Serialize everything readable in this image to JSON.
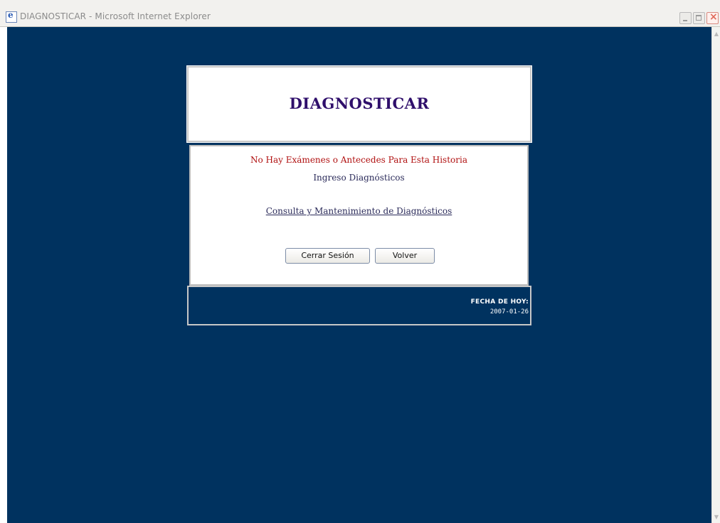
{
  "window": {
    "title": "DIAGNOSTICAR - Microsoft Internet Explorer",
    "icon": "internet-explorer-icon"
  },
  "page": {
    "title": "DIAGNOSTICAR",
    "error_message": "No Hay Exámenes o Antecedes Para Esta Historia",
    "subtitle": "Ingreso Diagnósticos",
    "link_label": "Consulta y Mantenimiento de Diagnósticos",
    "buttons": {
      "logout": "Cerrar Sesión",
      "back": "Volver"
    },
    "footer": {
      "date_label": "FECHA DE HOY:",
      "date_value": "2007-01-26"
    }
  },
  "colors": {
    "background": "#00325f",
    "title": "#2f0f6b",
    "error": "#b01010"
  }
}
